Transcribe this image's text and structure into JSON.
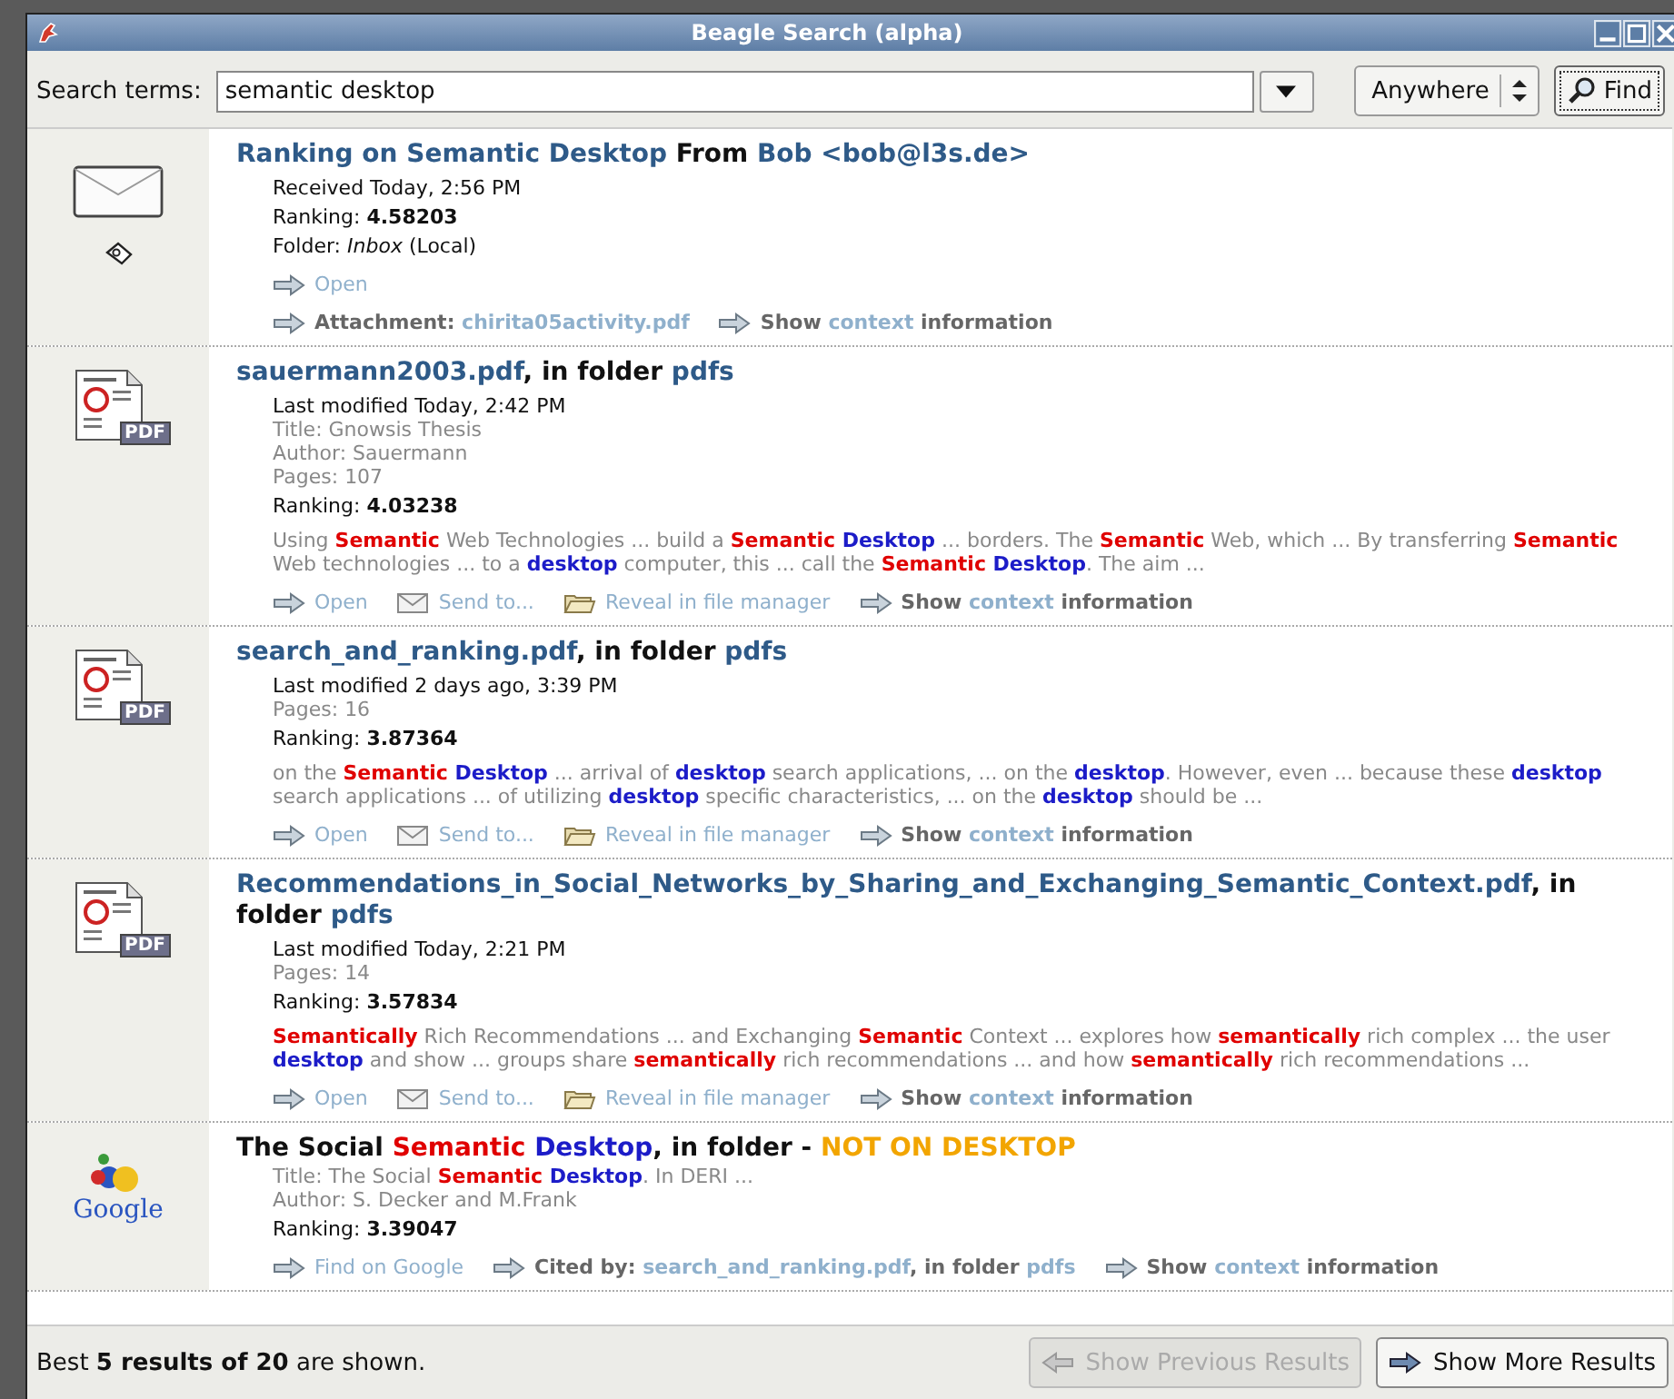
{
  "window": {
    "title": "Beagle Search (alpha)"
  },
  "search": {
    "label": "Search terms:",
    "value": "semantic desktop",
    "scope": "Anywhere",
    "find_button": "Find"
  },
  "results": [
    {
      "icon": {
        "kind": "mail"
      },
      "title": [
        {
          "text": "Ranking on Semantic Desktop",
          "kind": "link"
        },
        {
          "text": " From ",
          "kind": "plain"
        },
        {
          "text": "Bob <bob@l3s.de>",
          "kind": "link"
        }
      ],
      "lines": [
        {
          "kind": "meta",
          "runs": [
            {
              "text": "Received Today, 2:56 PM",
              "kind": "plain"
            }
          ]
        },
        {
          "kind": "meta",
          "runs": [
            {
              "text": "Ranking: ",
              "kind": "plain"
            },
            {
              "text": "4.58203",
              "kind": "bold"
            }
          ]
        },
        {
          "kind": "meta",
          "runs": [
            {
              "text": "Folder: ",
              "kind": "plain"
            },
            {
              "text": "Inbox",
              "kind": "italic"
            },
            {
              "text": " (Local)",
              "kind": "plain"
            }
          ]
        }
      ],
      "action_rows": [
        [
          {
            "kind": "arrow",
            "runs": [
              {
                "text": "Open",
                "kind": "link"
              }
            ]
          }
        ],
        [
          {
            "kind": "arrow",
            "runs": [
              {
                "text": "Attachment: ",
                "kind": "label"
              },
              {
                "text": "chirita05activity.pdf",
                "kind": "link"
              }
            ]
          },
          {
            "kind": "arrow",
            "runs": [
              {
                "text": "Show ",
                "kind": "label"
              },
              {
                "text": "context",
                "kind": "link"
              },
              {
                "text": " information",
                "kind": "label"
              }
            ]
          }
        ]
      ]
    },
    {
      "icon": {
        "kind": "pdf",
        "badge": "PDF"
      },
      "title": [
        {
          "text": "sauermann2003.pdf",
          "kind": "link"
        },
        {
          "text": ", in folder ",
          "kind": "plain"
        },
        {
          "text": "pdfs",
          "kind": "link"
        }
      ],
      "lines": [
        {
          "kind": "meta",
          "runs": [
            {
              "text": "Last modified Today, 2:42 PM",
              "kind": "plain"
            }
          ]
        },
        {
          "kind": "dim",
          "runs": [
            {
              "text": "Title: Gnowsis Thesis",
              "kind": "plain"
            }
          ]
        },
        {
          "kind": "dim",
          "runs": [
            {
              "text": "Author: Sauermann",
              "kind": "plain"
            }
          ]
        },
        {
          "kind": "dim",
          "runs": [
            {
              "text": "Pages: 107",
              "kind": "plain"
            }
          ]
        },
        {
          "kind": "meta",
          "runs": [
            {
              "text": "Ranking: ",
              "kind": "plain"
            },
            {
              "text": "4.03238",
              "kind": "bold"
            }
          ]
        },
        {
          "kind": "snippet",
          "runs": [
            {
              "text": "Using ",
              "kind": "plain"
            },
            {
              "text": "Semantic",
              "kind": "hit",
              "color": "#e00000"
            },
            {
              "text": " Web Technologies ... build a ",
              "kind": "plain"
            },
            {
              "text": "Semantic ",
              "kind": "hit",
              "color": "#e00000"
            },
            {
              "text": "Desktop",
              "kind": "hit",
              "color": "#1c1cc8"
            },
            {
              "text": " ... borders. The ",
              "kind": "plain"
            },
            {
              "text": "Semantic",
              "kind": "hit",
              "color": "#e00000"
            },
            {
              "text": " Web, which ... By transferring ",
              "kind": "plain"
            },
            {
              "text": "Semantic",
              "kind": "hit",
              "color": "#e00000"
            },
            {
              "text": " Web technologies ... to a ",
              "kind": "plain"
            },
            {
              "text": "desktop",
              "kind": "hit",
              "color": "#1c1cc8"
            },
            {
              "text": " computer, this ... call the ",
              "kind": "plain"
            },
            {
              "text": "Semantic ",
              "kind": "hit",
              "color": "#e00000"
            },
            {
              "text": "Desktop",
              "kind": "hit",
              "color": "#1c1cc8"
            },
            {
              "text": ". The aim ...",
              "kind": "plain"
            }
          ]
        }
      ],
      "action_rows": [
        [
          {
            "kind": "arrow",
            "runs": [
              {
                "text": "Open",
                "kind": "link"
              }
            ]
          },
          {
            "kind": "mail",
            "runs": [
              {
                "text": "Send to...",
                "kind": "link"
              }
            ]
          },
          {
            "kind": "folder",
            "runs": [
              {
                "text": "Reveal in file manager",
                "kind": "link"
              }
            ]
          },
          {
            "kind": "arrow",
            "runs": [
              {
                "text": "Show ",
                "kind": "label"
              },
              {
                "text": "context",
                "kind": "link"
              },
              {
                "text": " information",
                "kind": "label"
              }
            ]
          }
        ]
      ]
    },
    {
      "icon": {
        "kind": "pdf",
        "badge": "PDF"
      },
      "title": [
        {
          "text": "search_and_ranking.pdf",
          "kind": "link"
        },
        {
          "text": ", in folder ",
          "kind": "plain"
        },
        {
          "text": "pdfs",
          "kind": "link"
        }
      ],
      "lines": [
        {
          "kind": "meta",
          "runs": [
            {
              "text": "Last modified 2 days ago, 3:39 PM",
              "kind": "plain"
            }
          ]
        },
        {
          "kind": "dim",
          "runs": [
            {
              "text": "Pages: 16",
              "kind": "plain"
            }
          ]
        },
        {
          "kind": "meta",
          "runs": [
            {
              "text": "Ranking: ",
              "kind": "plain"
            },
            {
              "text": "3.87364",
              "kind": "bold"
            }
          ]
        },
        {
          "kind": "snippet",
          "runs": [
            {
              "text": "on the ",
              "kind": "plain"
            },
            {
              "text": "Semantic ",
              "kind": "hit",
              "color": "#e00000"
            },
            {
              "text": "Desktop",
              "kind": "hit",
              "color": "#1c1cc8"
            },
            {
              "text": " ... arrival of ",
              "kind": "plain"
            },
            {
              "text": "desktop",
              "kind": "hit",
              "color": "#1c1cc8"
            },
            {
              "text": " search applications, ... on the ",
              "kind": "plain"
            },
            {
              "text": "desktop",
              "kind": "hit",
              "color": "#1c1cc8"
            },
            {
              "text": ". However, even ... because these ",
              "kind": "plain"
            },
            {
              "text": "desktop",
              "kind": "hit",
              "color": "#1c1cc8"
            },
            {
              "text": " search applications ... of utilizing ",
              "kind": "plain"
            },
            {
              "text": "desktop",
              "kind": "hit",
              "color": "#1c1cc8"
            },
            {
              "text": " specific characteristics, ... on the ",
              "kind": "plain"
            },
            {
              "text": "desktop",
              "kind": "hit",
              "color": "#1c1cc8"
            },
            {
              "text": " should be ...",
              "kind": "plain"
            }
          ]
        }
      ],
      "action_rows": [
        [
          {
            "kind": "arrow",
            "runs": [
              {
                "text": "Open",
                "kind": "link"
              }
            ]
          },
          {
            "kind": "mail",
            "runs": [
              {
                "text": "Send to...",
                "kind": "link"
              }
            ]
          },
          {
            "kind": "folder",
            "runs": [
              {
                "text": "Reveal in file manager",
                "kind": "link"
              }
            ]
          },
          {
            "kind": "arrow",
            "runs": [
              {
                "text": "Show ",
                "kind": "label"
              },
              {
                "text": "context",
                "kind": "link"
              },
              {
                "text": " information",
                "kind": "label"
              }
            ]
          }
        ]
      ]
    },
    {
      "icon": {
        "kind": "pdf",
        "badge": "PDF"
      },
      "title": [
        {
          "text": "Recommendations_in_Social_Networks_by_Sharing_and_Exchanging_Semantic_Context.pdf",
          "kind": "link"
        },
        {
          "text": ", in folder ",
          "kind": "plain"
        },
        {
          "text": "pdfs",
          "kind": "link"
        }
      ],
      "lines": [
        {
          "kind": "meta",
          "runs": [
            {
              "text": "Last modified Today, 2:21 PM",
              "kind": "plain"
            }
          ]
        },
        {
          "kind": "dim",
          "runs": [
            {
              "text": "Pages: 14",
              "kind": "plain"
            }
          ]
        },
        {
          "kind": "meta",
          "runs": [
            {
              "text": "Ranking: ",
              "kind": "plain"
            },
            {
              "text": "3.57834",
              "kind": "bold"
            }
          ]
        },
        {
          "kind": "snippet",
          "runs": [
            {
              "text": "Semantically",
              "kind": "hit",
              "color": "#e00000"
            },
            {
              "text": " Rich Recommendations ... and Exchanging ",
              "kind": "plain"
            },
            {
              "text": "Semantic",
              "kind": "hit",
              "color": "#e00000"
            },
            {
              "text": " Context ... explores how ",
              "kind": "plain"
            },
            {
              "text": "semantically",
              "kind": "hit",
              "color": "#e00000"
            },
            {
              "text": " rich complex ... the user ",
              "kind": "plain"
            },
            {
              "text": "desktop",
              "kind": "hit",
              "color": "#1c1cc8"
            },
            {
              "text": " and show ... groups share ",
              "kind": "plain"
            },
            {
              "text": "semantically",
              "kind": "hit",
              "color": "#e00000"
            },
            {
              "text": " rich recommendations ... and how ",
              "kind": "plain"
            },
            {
              "text": "semantically",
              "kind": "hit",
              "color": "#e00000"
            },
            {
              "text": " rich recommendations ...",
              "kind": "plain"
            }
          ]
        }
      ],
      "action_rows": [
        [
          {
            "kind": "arrow",
            "runs": [
              {
                "text": "Open",
                "kind": "link"
              }
            ]
          },
          {
            "kind": "mail",
            "runs": [
              {
                "text": "Send to...",
                "kind": "link"
              }
            ]
          },
          {
            "kind": "folder",
            "runs": [
              {
                "text": "Reveal in file manager",
                "kind": "link"
              }
            ]
          },
          {
            "kind": "arrow",
            "runs": [
              {
                "text": "Show ",
                "kind": "label"
              },
              {
                "text": "context",
                "kind": "link"
              },
              {
                "text": " information",
                "kind": "label"
              }
            ]
          }
        ]
      ]
    },
    {
      "icon": {
        "kind": "google",
        "label": "Google"
      },
      "title": [
        {
          "text": "The Social ",
          "kind": "plain"
        },
        {
          "text": "Semantic ",
          "kind": "hit",
          "color": "#e00000"
        },
        {
          "text": "Desktop",
          "kind": "hit",
          "color": "#1c1cc8"
        },
        {
          "text": ", in folder - ",
          "kind": "plain"
        },
        {
          "text": "NOT ON DESKTOP",
          "kind": "warning"
        }
      ],
      "lines": [
        {
          "kind": "dim",
          "runs": [
            {
              "text": "Title: The Social ",
              "kind": "plain"
            },
            {
              "text": "Semantic ",
              "kind": "hit",
              "color": "#e00000"
            },
            {
              "text": "Desktop",
              "kind": "hit",
              "color": "#1c1cc8"
            },
            {
              "text": ". In DERI ...",
              "kind": "plain"
            }
          ]
        },
        {
          "kind": "dim",
          "runs": [
            {
              "text": "Author: S. Decker and M.Frank",
              "kind": "plain"
            }
          ]
        },
        {
          "kind": "meta",
          "runs": [
            {
              "text": "Ranking: ",
              "kind": "plain"
            },
            {
              "text": "3.39047",
              "kind": "bold"
            }
          ]
        }
      ],
      "action_rows": [
        [
          {
            "kind": "arrow",
            "runs": [
              {
                "text": "Find on Google",
                "kind": "link"
              }
            ]
          },
          {
            "kind": "arrow",
            "runs": [
              {
                "text": "Cited by: ",
                "kind": "label"
              },
              {
                "text": "search_and_ranking.pdf",
                "kind": "link"
              },
              {
                "text": ", in folder ",
                "kind": "label"
              },
              {
                "text": "pdfs",
                "kind": "link"
              }
            ]
          },
          {
            "kind": "arrow",
            "runs": [
              {
                "text": "Show ",
                "kind": "label"
              },
              {
                "text": "context",
                "kind": "link"
              },
              {
                "text": " information",
                "kind": "label"
              }
            ]
          }
        ]
      ]
    }
  ],
  "status": "Best **5 results of 20** are shown.",
  "buttons": [
    {
      "label": "Show Previous Results",
      "kind": "back",
      "disabled": true
    },
    {
      "label": "Show More Results",
      "kind": "forward",
      "disabled": false
    }
  ]
}
